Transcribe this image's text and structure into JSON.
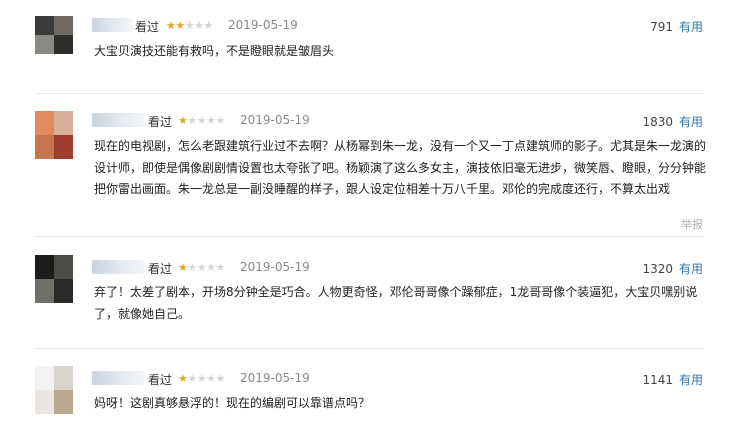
{
  "reviews": [
    {
      "status": "看过",
      "rating": 2,
      "date": "2019-05-19",
      "votes": "791",
      "useful_label": "有用",
      "content": "大宝贝演技还能有救吗，不是瞪眼就是皱眉头"
    },
    {
      "status": "看过",
      "rating": 1,
      "date": "2019-05-19",
      "votes": "1830",
      "useful_label": "有用",
      "content": "现在的电视剧，怎么老跟建筑行业过不去啊？从杨幂到朱一龙，没有一个又一丁点建筑师的影子。尤其是朱一龙演的设计师，即使是偶像剧剧情设置也太夸张了吧。杨颖演了这么多女主，演技依旧毫无进步，微笑唇、瞪眼，分分钟能把你雷出画面。朱一龙总是一副没睡醒的样子，跟人设定位相差十万八千里。邓伦的完成度还行，不算太出戏",
      "report_label": "举报"
    },
    {
      "status": "看过",
      "rating": 1,
      "date": "2019-05-19",
      "votes": "1320",
      "useful_label": "有用",
      "content": "弃了！太差了剧本，开场8分钟全是巧合。人物更奇怪，邓伦哥哥像个躁郁症，1龙哥哥像个装逼犯，大宝贝嘿别说了，就像她自己。"
    },
    {
      "status": "看过",
      "rating": 1,
      "date": "2019-05-19",
      "votes": "1141",
      "useful_label": "有用",
      "content": "妈呀！这剧真够悬浮的！现在的编剧可以靠谱点吗？"
    }
  ],
  "colors": {
    "star_on": "#e6a81c",
    "star_off": "#d6d6d6",
    "useful_link": "#3377aa",
    "date": "#8a8a8a"
  }
}
